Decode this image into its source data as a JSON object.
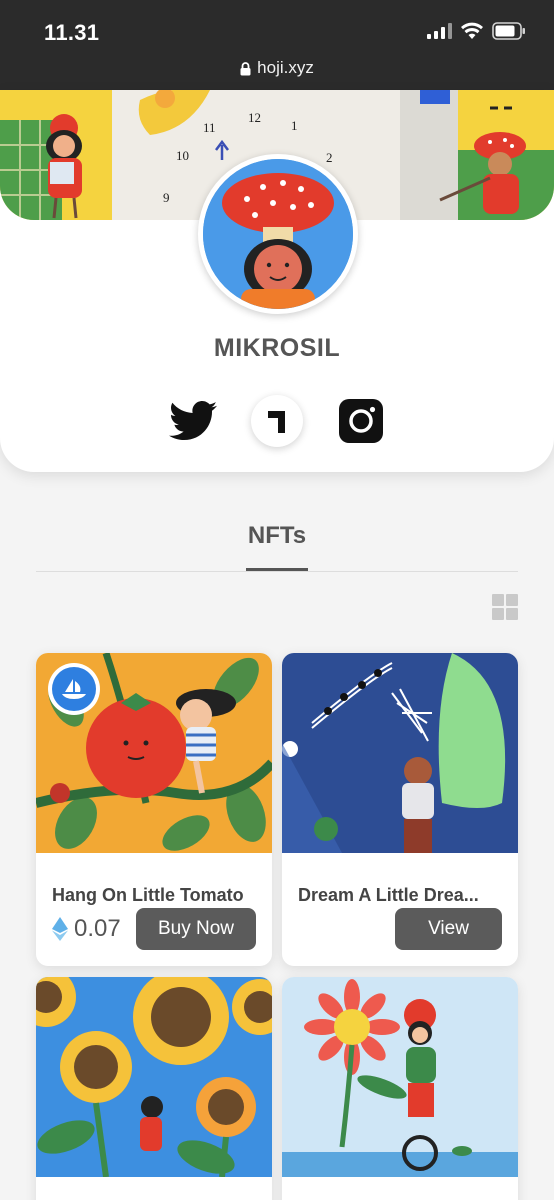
{
  "status_bar": {
    "time": "11.31"
  },
  "browser": {
    "url": "hoji.xyz"
  },
  "profile": {
    "name": "MIKROSIL",
    "socials": [
      {
        "name": "twitter-icon"
      },
      {
        "name": "hoji-icon"
      },
      {
        "name": "instagram-icon"
      }
    ]
  },
  "banner_clock_numbers": [
    "12",
    "1",
    "11",
    "10",
    "2",
    "9"
  ],
  "tabs": {
    "active": "NFTs"
  },
  "nfts": [
    {
      "title": "Hang On Little Tomato",
      "price": "0.07",
      "button": "Buy Now",
      "marketplace": "opensea-icon"
    },
    {
      "title": "Dream A Little Drea...",
      "button": "View"
    },
    {
      "title": ""
    },
    {
      "title": ""
    }
  ],
  "colors": {
    "button": "#5b5b5b",
    "eth": "#5fb0e8",
    "opensea": "#2e7fe0"
  }
}
